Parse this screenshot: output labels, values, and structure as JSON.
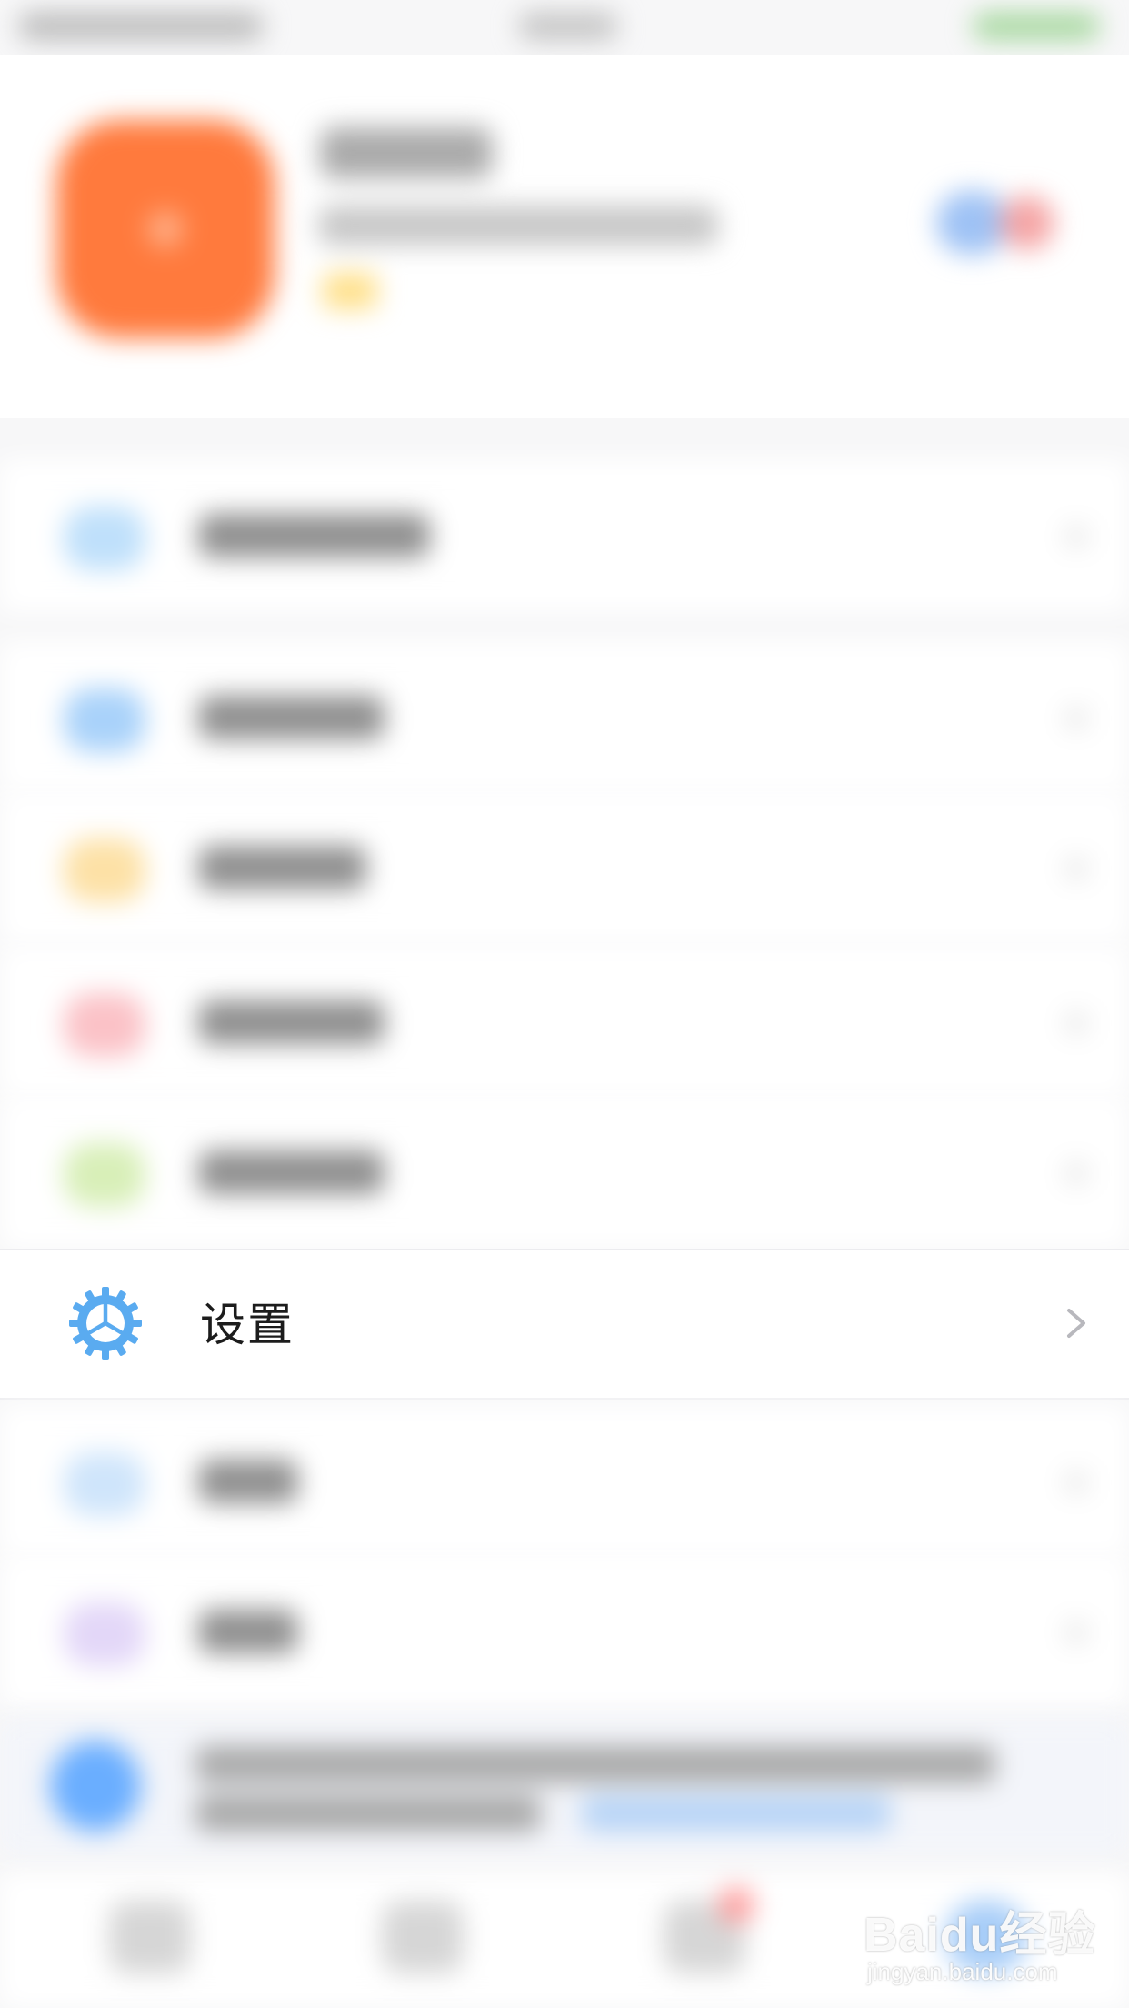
{
  "settings_row": {
    "label": "设置",
    "icon": "gear-icon",
    "icon_color": "#5aabf0"
  },
  "watermark": {
    "brand": "Baidu经验",
    "url": "jingyan.baidu.com"
  },
  "colors": {
    "avatar": "#ff7a3d",
    "accent_blue": "#5aabf0",
    "background": "#f7f7f8"
  }
}
